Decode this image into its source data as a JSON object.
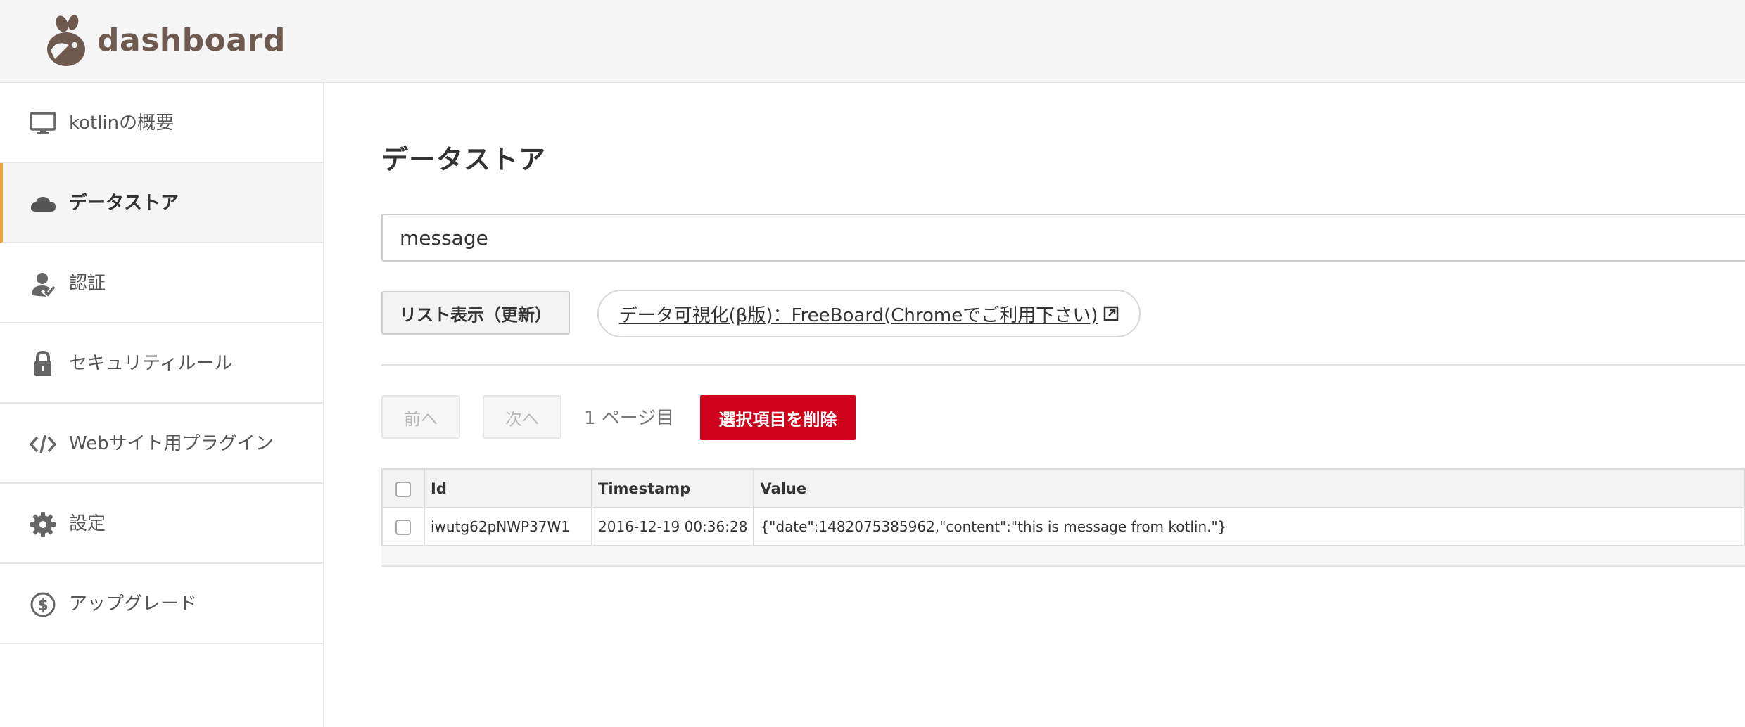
{
  "header": {
    "app_name": "dashboard",
    "brand_color": "#6e5a4f"
  },
  "sidebar": {
    "accent_color": "#f0a43c",
    "items": [
      {
        "label": "kotlinの概要",
        "icon": "monitor-icon",
        "active": false
      },
      {
        "label": "データストア",
        "icon": "cloud-icon",
        "active": true
      },
      {
        "label": "認証",
        "icon": "user-check-icon",
        "active": false
      },
      {
        "label": "セキュリティルール",
        "icon": "lock-icon",
        "active": false
      },
      {
        "label": "Webサイト用プラグイン",
        "icon": "code-icon",
        "active": false
      },
      {
        "label": "設定",
        "icon": "gear-icon",
        "active": false
      },
      {
        "label": "アップグレード",
        "icon": "dollar-circle-icon",
        "active": false
      }
    ]
  },
  "main": {
    "title": "データストア",
    "search": {
      "value": "message",
      "placeholder": ""
    },
    "list_button": "リスト表示（更新）",
    "visualize_link": "データ可視化(β版)：FreeBoard(Chromeでご利用下さい)",
    "pagination": {
      "prev": "前へ",
      "next": "次へ",
      "page_label": "1 ページ目"
    },
    "delete_button": "選択項目を削除",
    "delete_color": "#d0021b",
    "table": {
      "columns": [
        "Id",
        "Timestamp",
        "Value"
      ],
      "rows": [
        {
          "id": "iwutg62pNWP37W1",
          "timestamp": "2016-12-19 00:36:28",
          "value": "{\"date\":1482075385962,\"content\":\"this is message from kotlin.\"}"
        }
      ]
    }
  }
}
